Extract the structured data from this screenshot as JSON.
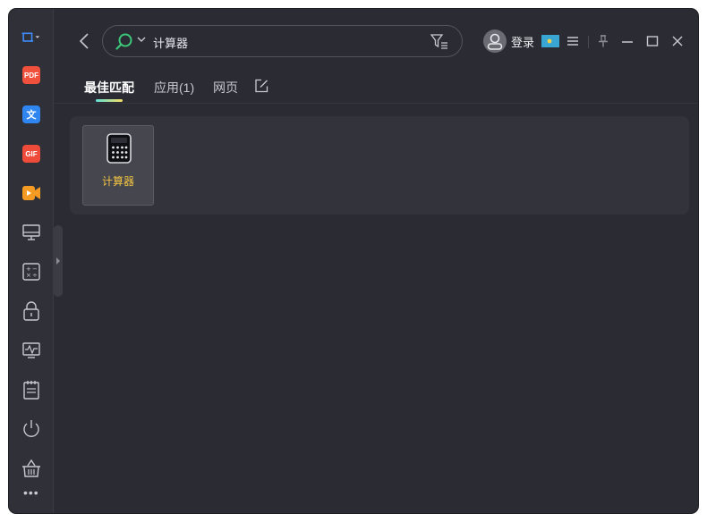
{
  "search": {
    "value": "计算器"
  },
  "header": {
    "login_label": "登录"
  },
  "tabs": [
    {
      "label": "最佳匹配",
      "active": true
    },
    {
      "label": "应用(1)",
      "active": false
    },
    {
      "label": "网页",
      "active": false
    }
  ],
  "results": [
    {
      "name": "计算器",
      "icon": "calculator-icon"
    }
  ],
  "sidebar": {
    "items": [
      {
        "icon": "screenshot-icon"
      },
      {
        "icon": "pdf-icon",
        "badge": "PDF"
      },
      {
        "icon": "translate-icon",
        "badge": "文"
      },
      {
        "icon": "gif-icon",
        "badge": "GIF"
      },
      {
        "icon": "video-icon"
      },
      {
        "icon": "monitor-icon"
      },
      {
        "icon": "calculator-tool-icon"
      },
      {
        "icon": "lock-icon"
      },
      {
        "icon": "system-monitor-icon"
      },
      {
        "icon": "notepad-icon"
      },
      {
        "icon": "power-icon"
      },
      {
        "icon": "basket-icon"
      }
    ]
  },
  "colors": {
    "window_bg": "#2b2c33",
    "accent_highlight": "#f4c542",
    "tab_underline_start": "#5fe0d7",
    "tab_underline_end": "#f6dd62",
    "search_icon": "#3cc77a"
  }
}
